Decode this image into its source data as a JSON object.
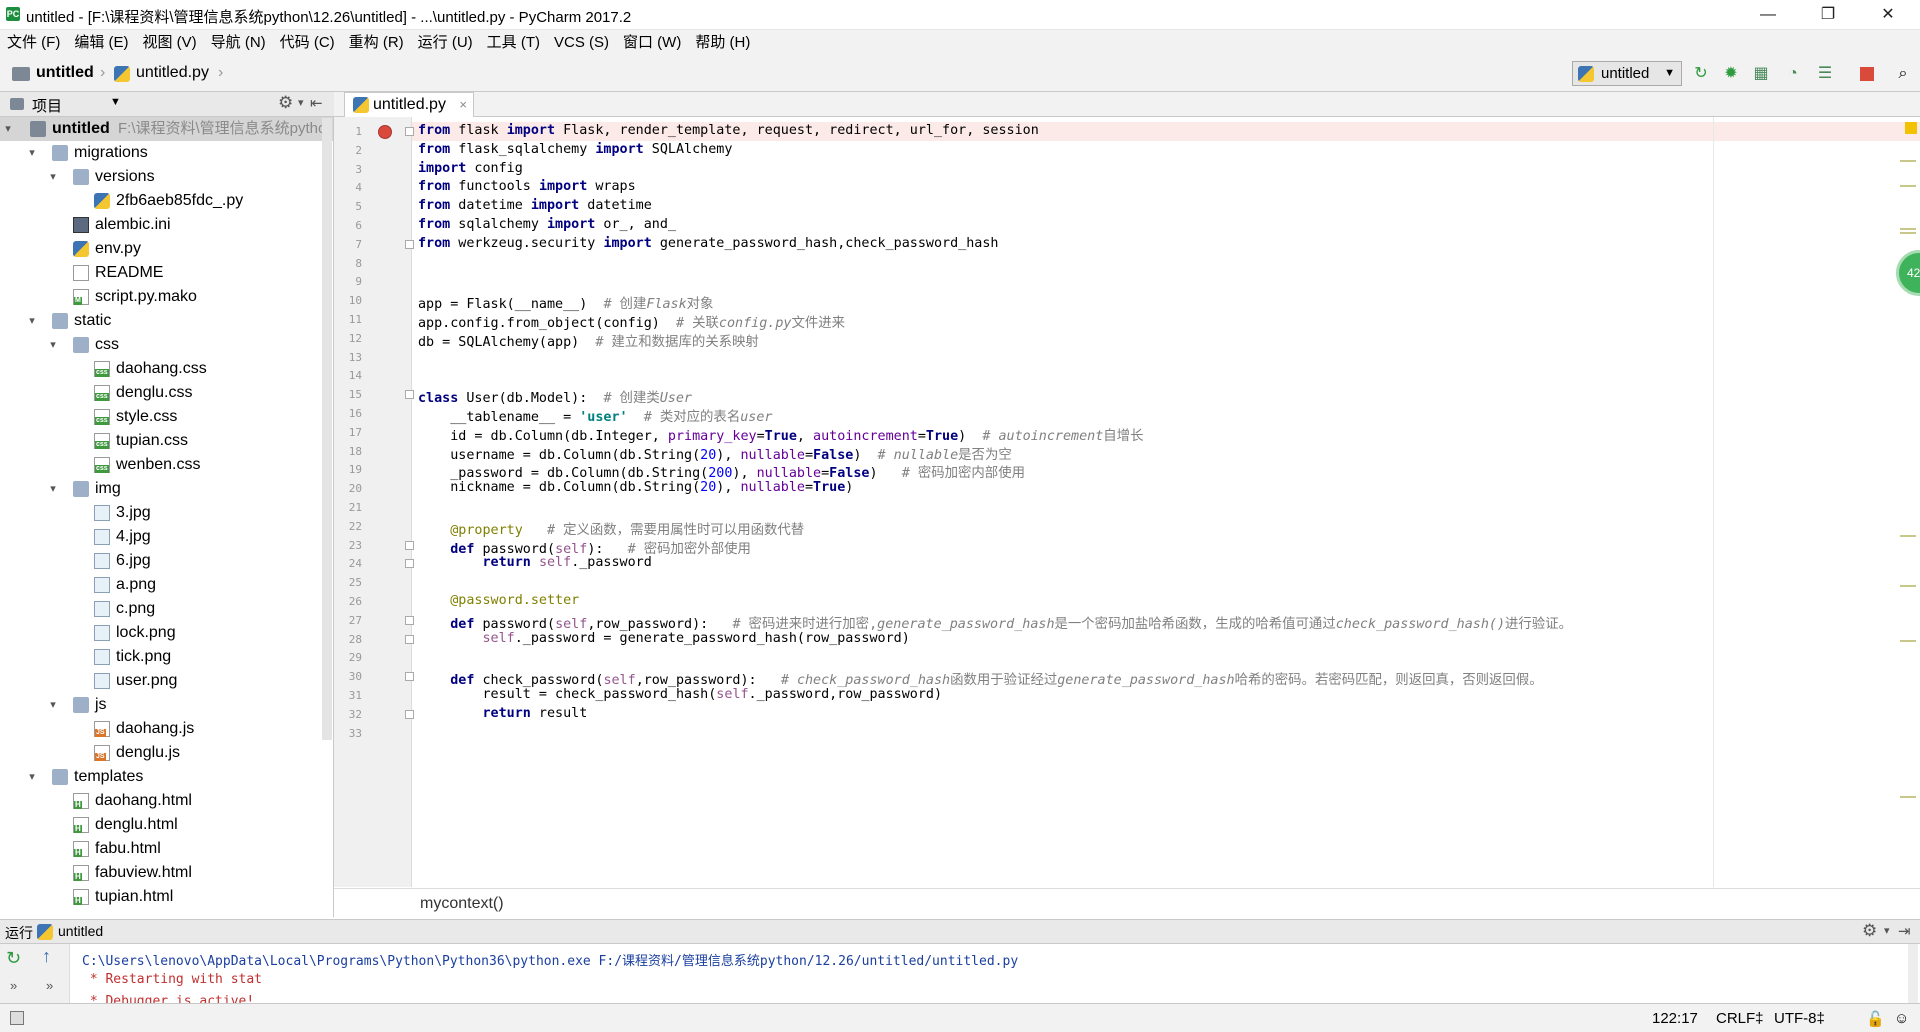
{
  "window": {
    "title": "untitled - [F:\\课程资料\\管理信息系统python\\12.26\\untitled] - ...\\untitled.py - PyCharm 2017.2",
    "minimize": "—",
    "maximize": "❐",
    "close": "✕"
  },
  "menu": [
    "文件 (F)",
    "编辑 (E)",
    "视图 (V)",
    "导航 (N)",
    "代码 (C)",
    "重构 (R)",
    "运行 (U)",
    "工具 (T)",
    "VCS (S)",
    "窗口 (W)",
    "帮助 (H)"
  ],
  "nav": {
    "project": "untitled",
    "file": "untitled.py",
    "run_config": "untitled"
  },
  "project_panel": {
    "title": "项目",
    "root_name": "untitled",
    "root_path": "F:\\课程资料\\管理信息系统pytho",
    "items": [
      {
        "label": "migrations",
        "type": "folder"
      },
      {
        "label": "versions",
        "type": "folder"
      },
      {
        "label": "2fb6aeb85fdc_.py",
        "type": "py"
      },
      {
        "label": "alembic.ini",
        "type": "ini"
      },
      {
        "label": "env.py",
        "type": "py"
      },
      {
        "label": "README",
        "type": "txt"
      },
      {
        "label": "script.py.mako",
        "type": "mako"
      },
      {
        "label": "static",
        "type": "folder"
      },
      {
        "label": "css",
        "type": "folder"
      },
      {
        "label": "daohang.css",
        "type": "css"
      },
      {
        "label": "denglu.css",
        "type": "css"
      },
      {
        "label": "style.css",
        "type": "css"
      },
      {
        "label": "tupian.css",
        "type": "css"
      },
      {
        "label": "wenben.css",
        "type": "css"
      },
      {
        "label": "img",
        "type": "folder"
      },
      {
        "label": "3.jpg",
        "type": "img"
      },
      {
        "label": "4.jpg",
        "type": "img"
      },
      {
        "label": "6.jpg",
        "type": "img"
      },
      {
        "label": "a.png",
        "type": "img"
      },
      {
        "label": "c.png",
        "type": "img"
      },
      {
        "label": "lock.png",
        "type": "img"
      },
      {
        "label": "tick.png",
        "type": "img"
      },
      {
        "label": "user.png",
        "type": "img"
      },
      {
        "label": "js",
        "type": "folder"
      },
      {
        "label": "daohang.js",
        "type": "js"
      },
      {
        "label": "denglu.js",
        "type": "js"
      },
      {
        "label": "templates",
        "type": "folder"
      },
      {
        "label": "daohang.html",
        "type": "html"
      },
      {
        "label": "denglu.html",
        "type": "html"
      },
      {
        "label": "fabu.html",
        "type": "html"
      },
      {
        "label": "fabuview.html",
        "type": "html"
      },
      {
        "label": "tupian.html",
        "type": "html"
      }
    ]
  },
  "editor": {
    "tab": "untitled.py",
    "context": "mycontext()",
    "line_numbers": [
      "1",
      "2",
      "3",
      "4",
      "5",
      "6",
      "7",
      "8",
      "9",
      "10",
      "11",
      "12",
      "13",
      "14",
      "15",
      "16",
      "17",
      "18",
      "19",
      "20",
      "21",
      "22",
      "23",
      "24",
      "25",
      "26",
      "27",
      "28",
      "29",
      "30",
      "31",
      "32",
      "33"
    ],
    "badge": "42"
  },
  "run": {
    "title": "运行",
    "config": "untitled",
    "line1": "C:\\Users\\lenovo\\AppData\\Local\\Programs\\Python\\Python36\\python.exe F:/课程资料/管理信息系统python/12.26/untitled/untitled.py",
    "line2": " * Restarting with stat",
    "line3": " * Debugger is active!"
  },
  "status": {
    "position": "122:17",
    "line_sep": "CRLF‡",
    "encoding": "UTF-8‡"
  }
}
